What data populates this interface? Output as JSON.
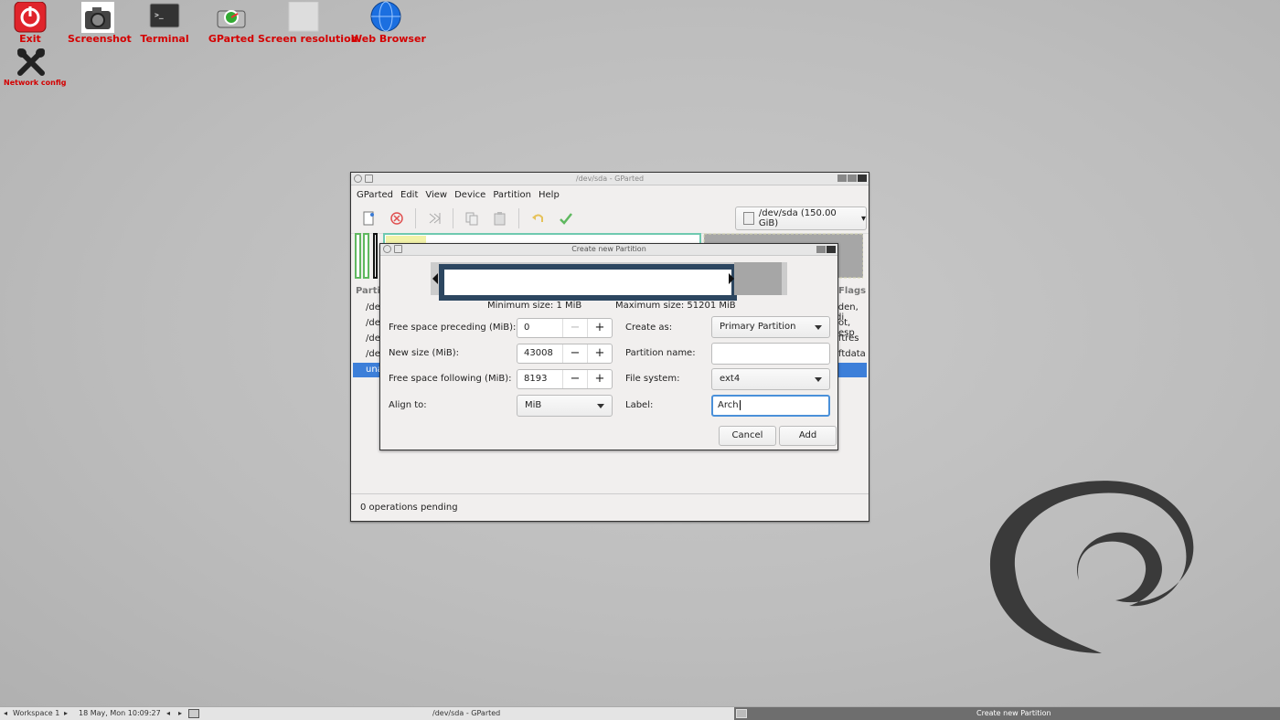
{
  "desktop": {
    "icons": [
      {
        "label": "Exit"
      },
      {
        "label": "Screenshot"
      },
      {
        "label": "Terminal"
      },
      {
        "label": "GParted"
      },
      {
        "label": "Screen resolution"
      },
      {
        "label": "Web Browser"
      },
      {
        "label": "Network config"
      }
    ]
  },
  "gparted": {
    "title": "/dev/sda - GParted",
    "menu": [
      "GParted",
      "Edit",
      "View",
      "Device",
      "Partition",
      "Help"
    ],
    "device": "/dev/sda (150.00 GiB)",
    "columns": {
      "partition": "Parti",
      "flags": "Flags"
    },
    "rows": [
      {
        "left": "/de",
        "right": "lden, di"
      },
      {
        "left": "/de",
        "right": "ot, esp"
      },
      {
        "left": "/de",
        "right": "ftres"
      },
      {
        "left": "/de",
        "right": "ftdata"
      },
      {
        "left": "una",
        "right": ""
      }
    ],
    "status": "0 operations pending"
  },
  "dialog": {
    "title": "Create new Partition",
    "min_size": "Minimum size: 1 MiB",
    "max_size": "Maximum size: 51201 MiB",
    "free_preceding_label": "Free space preceding (MiB):",
    "free_preceding_value": "0",
    "new_size_label": "New size (MiB):",
    "new_size_value": "43008",
    "free_following_label": "Free space following (MiB):",
    "free_following_value": "8193",
    "align_label": "Align to:",
    "align_value": "MiB",
    "create_as_label": "Create as:",
    "create_as_value": "Primary Partition",
    "partition_name_label": "Partition name:",
    "partition_name_value": "",
    "filesystem_label": "File system:",
    "filesystem_value": "ext4",
    "label_label": "Label:",
    "label_value": "Arch",
    "cancel": "Cancel",
    "add": "Add"
  },
  "taskbar": {
    "workspace": "Workspace 1",
    "datetime": "18 May, Mon 10:09:27",
    "task1": "/dev/sda - GParted",
    "task2": "Create new Partition"
  },
  "colors": {
    "desktop_label": "#d40000",
    "selection": "#3d7fd9",
    "focus": "#4a90d9",
    "bar_border": "#2c4660"
  }
}
